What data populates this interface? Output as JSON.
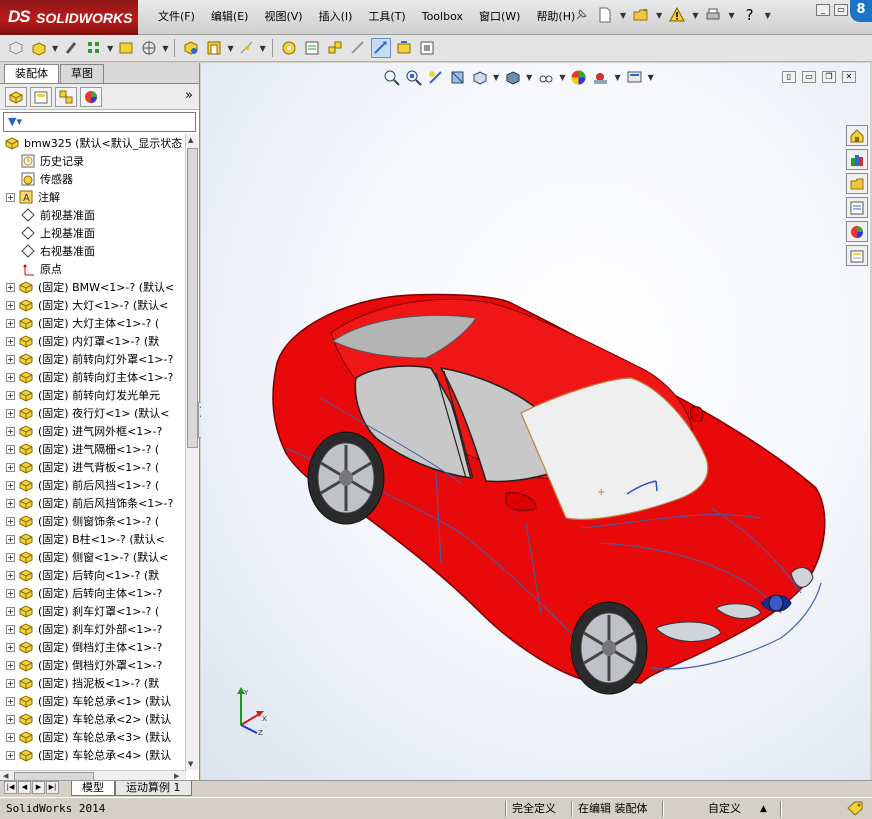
{
  "app": {
    "logo_ds": "DS",
    "logo_name": "SOLIDWORKS"
  },
  "menus": [
    "文件(F)",
    "编辑(E)",
    "视图(V)",
    "插入(I)",
    "工具(T)",
    "Toolbox",
    "窗口(W)",
    "帮助(H)"
  ],
  "left_tabs": {
    "assembly": "装配体",
    "sketch": "草图"
  },
  "tree": {
    "root": "bmw325  (默认<默认_显示状态",
    "history": "历史记录",
    "sensors": "传感器",
    "annotations": "注解",
    "front_plane": "前视基准面",
    "top_plane": "上视基准面",
    "right_plane": "右视基准面",
    "origin": "原点",
    "components": [
      "(固定) BMW<1>-?  (默认<",
      "(固定) 大灯<1>-?  (默认<",
      "(固定) 大灯主体<1>-?  (",
      "(固定) 内灯罩<1>-?  (默",
      "(固定) 前转向灯外罩<1>-?",
      "(固定) 前转向灯主体<1>-?",
      "(固定) 前转向灯发光单元",
      "(固定) 夜行灯<1>  (默认<",
      "(固定) 进气网外框<1>-?",
      "(固定) 进气隔栅<1>-?  (",
      "(固定) 进气背板<1>-?  (",
      "(固定) 前后风挡<1>-?  (",
      "(固定) 前后风挡饰条<1>-?",
      "(固定) 侧窗饰条<1>-?  (",
      "(固定) B柱<1>-?  (默认<",
      "(固定) 侧窗<1>-?  (默认<",
      "(固定) 后转向<1>-?  (默",
      "(固定) 后转向主体<1>-?",
      "(固定) 刹车灯罩<1>-?  (",
      "(固定) 刹车灯外部<1>-?",
      "(固定) 倒档灯主体<1>-?",
      "(固定) 倒档灯外罩<1>-?",
      "(固定) 挡泥板<1>-?  (默",
      "(固定) 车轮总承<1>  (默认",
      "(固定) 车轮总承<2>  (默认",
      "(固定) 车轮总承<3>  (默认",
      "(固定) 车轮总承<4>  (默认"
    ]
  },
  "bottom_tabs": {
    "model": "模型",
    "motion": "运动算例 1"
  },
  "status": {
    "app_version": "SolidWorks 2014",
    "defined": "完全定义",
    "editing": "在编辑 装配体",
    "units": "自定义"
  },
  "colors": {
    "car_body": "#ee0b0b",
    "accent": "#1e64c8",
    "logo_red": "#c01a1a"
  }
}
